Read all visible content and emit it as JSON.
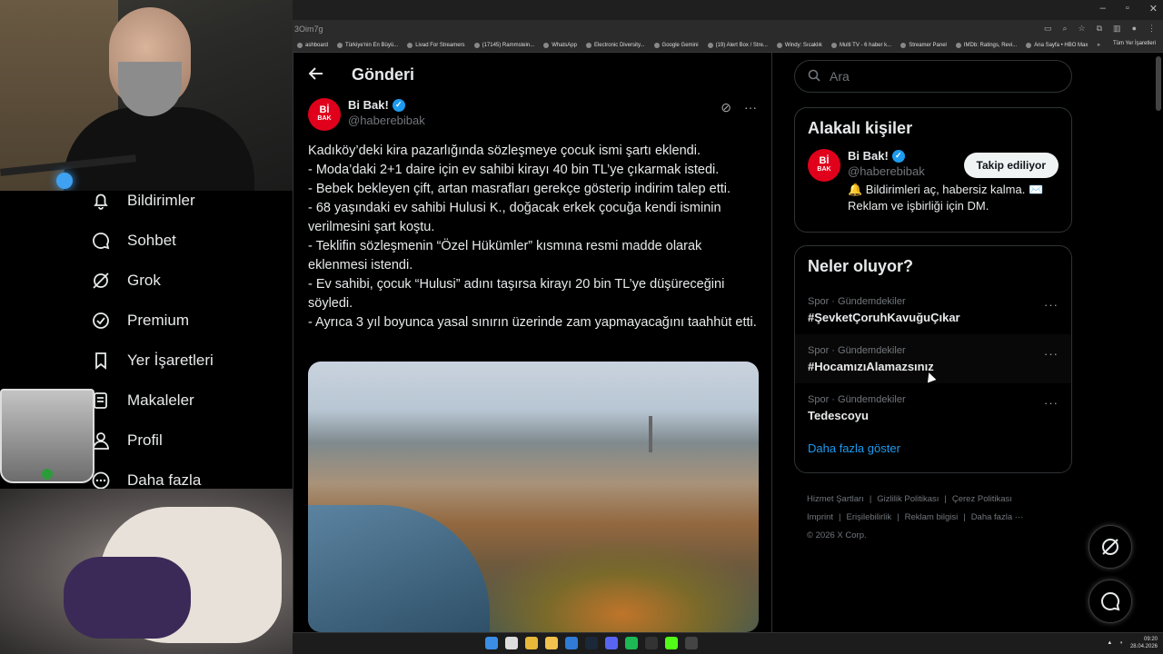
{
  "browser": {
    "address_text": "3Oim7g",
    "bookmarks": [
      "ashboard",
      "Türkiye'nin En Büyü...",
      "Livad For Streamers",
      "(17145) Rammstein...",
      "WhatsApp",
      "Electronic Diversity...",
      "Google Gemini",
      "(19) Alert Box / Stre...",
      "Windy: Sıcaklık",
      "Multi TV - 6 haber k...",
      "Streamer Panel",
      "IMDb: Ratings, Revi...",
      "Ana Sayfa • HBO Max"
    ],
    "bookmarks_more": "»",
    "bookmarks_folder": "Tüm Yer İşaretleri"
  },
  "left_nav": [
    {
      "label": "Bildirimler",
      "icon": "bell-icon"
    },
    {
      "label": "Sohbet",
      "icon": "chat-icon"
    },
    {
      "label": "Grok",
      "icon": "grok-icon"
    },
    {
      "label": "Premium",
      "icon": "premium-icon"
    },
    {
      "label": "Yer İşaretleri",
      "icon": "bookmark-icon"
    },
    {
      "label": "Makaleler",
      "icon": "article-icon"
    },
    {
      "label": "Profil",
      "icon": "profile-icon"
    },
    {
      "label": "Daha fazla",
      "icon": "more-icon"
    }
  ],
  "main": {
    "header_title": "Gönderi",
    "author": {
      "name": "Bi Bak!",
      "handle": "@haberebibak",
      "avatar_text": "Bİ",
      "avatar_sub": "BAK"
    },
    "post_text": "Kadıköy’deki kira pazarlığında sözleşmeye çocuk ismi şartı eklendi.\n- Moda’daki 2+1 daire için ev sahibi kirayı 40 bin TL’ye çıkarmak istedi.\n- Bebek bekleyen çift, artan masrafları gerekçe gösterip indirim talep etti.\n- 68 yaşındaki ev sahibi Hulusi K., doğacak erkek çocuğa kendi isminin verilmesini şart koştu.\n- Teklifin sözleşmenin “Özel Hükümler” kısmına resmi madde olarak eklenmesi istendi.\n- Ev sahibi, çocuk “Hulusi” adını taşırsa kirayı 20 bin TL’ye düşüreceğini söyledi.\n- Ayrıca 3 yıl boyunca yasal sınırın üzerinde zam yapmayacağını taahhüt etti."
  },
  "right": {
    "search_placeholder": "Ara",
    "related_title": "Alakalı kişiler",
    "related_user": {
      "name": "Bi Bak!",
      "handle": "@haberebibak",
      "button": "Takip ediliyor",
      "bio": "🔔 Bildirimleri aç, habersiz kalma. ✉️ Reklam ve işbirliği için DM."
    },
    "trends_title": "Neler oluyor?",
    "trends": [
      {
        "category": "Spor · Gündemdekiler",
        "tag": "#ŞevketÇoruhKavuğuÇıkar"
      },
      {
        "category": "Spor · Gündemdekiler",
        "tag": "#HocamızıAlamazsınız"
      },
      {
        "category": "Spor · Gündemdekiler",
        "tag": "Tedescoyu"
      }
    ],
    "show_more": "Daha fazla göster",
    "footer": [
      "Hizmet Şartları",
      "Gizlilik Politikası",
      "Çerez Politikası",
      "Imprint",
      "Erişilebilirlik",
      "Reklam bilgisi",
      "Daha fazla ···",
      "© 2026 X Corp."
    ]
  },
  "taskbar": {
    "time": "09:20",
    "date": "28.04.2026"
  }
}
